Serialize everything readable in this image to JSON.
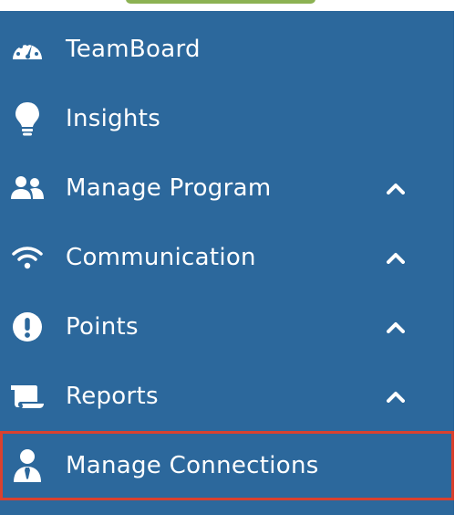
{
  "menu": {
    "items": [
      {
        "label": "TeamBoard",
        "icon": "dashboard-gauge-icon",
        "expandable": false
      },
      {
        "label": "Insights",
        "icon": "lightbulb-icon",
        "expandable": false
      },
      {
        "label": "Manage Program",
        "icon": "users-icon",
        "expandable": true
      },
      {
        "label": "Communication",
        "icon": "wifi-icon",
        "expandable": true
      },
      {
        "label": "Points",
        "icon": "exclamation-circle-icon",
        "expandable": true
      },
      {
        "label": "Reports",
        "icon": "scroll-icon",
        "expandable": true
      },
      {
        "label": "Manage Connections",
        "icon": "user-tie-icon",
        "expandable": false,
        "highlighted": true
      }
    ]
  },
  "colors": {
    "sidebar_bg": "#2c689c",
    "highlight_border": "#d9412f",
    "top_pill": "#8cb253"
  }
}
